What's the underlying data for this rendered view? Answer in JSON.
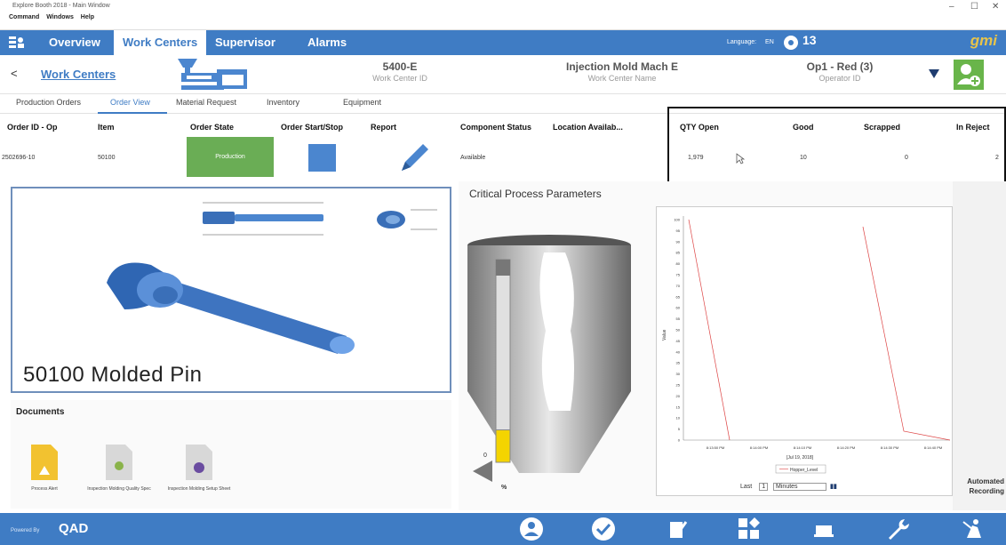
{
  "window": {
    "title": "Explore Booth 2018 - Main Window",
    "menu": [
      "Command",
      "Windows",
      "Help"
    ],
    "controls": [
      "–",
      "☐",
      "✕"
    ]
  },
  "nav": {
    "tabs": [
      "Overview",
      "Work Centers",
      "Supervisor",
      "Alarms"
    ],
    "active_tab": "Work Centers",
    "language_label": "Language:",
    "language_value": "EN",
    "alert_count": "13",
    "brand": "gmi"
  },
  "work_center": {
    "back_label": "<",
    "title": "Work Centers",
    "id_value": "5400-E",
    "id_label": "Work Center ID",
    "name_value": "Injection Mold Mach E",
    "name_label": "Work Center Name",
    "operator_value": "Op1 - Red (3)",
    "operator_label": "Operator ID"
  },
  "subtabs": [
    "Production Orders",
    "Order View",
    "Material Request",
    "Inventory",
    "Equipment"
  ],
  "active_subtab": "Order View",
  "order_table": {
    "headers": [
      "Order ID - Op",
      "Item",
      "Order State",
      "Order Start/Stop",
      "Report",
      "Component Status",
      "Location Availab...",
      "QTY Open",
      "Good",
      "Scrapped",
      "In Reject"
    ],
    "row": {
      "order_id": "2502696-10",
      "item": "50100",
      "state": "Production",
      "component_status": "Available",
      "qty_open": "1,979",
      "good": "10",
      "scrapped": "0",
      "in_reject": "2"
    }
  },
  "part": {
    "title": "50100 Molded Pin"
  },
  "documents": {
    "title": "Documents",
    "items": [
      {
        "label": "Process Alert",
        "color": "#f2c230"
      },
      {
        "label": "Inspection Molding Quality Spec",
        "color": "#8ab34a"
      },
      {
        "label": "Inspection Molding Setup Sheet",
        "color": "#6a4ca0"
      }
    ]
  },
  "critical": {
    "title": "Critical Process Parameters",
    "gauge_zero": "0",
    "gauge_unit": "%",
    "gauge_level": 0.16,
    "axis_ylabel": "Value",
    "time_labels": [
      "8:13:50 PM",
      "8:14:00 PM",
      "8:14:10 PM",
      "8:14:20 PM",
      "8:14:30 PM",
      "8:14:40 PM"
    ],
    "date_label": "[Jul 19, 2018]",
    "legend": "Hopper_Level",
    "last_label": "Last",
    "last_value": "1",
    "unit_value": "Minutes",
    "y_ticks": [
      "100",
      "95",
      "90",
      "85",
      "80",
      "75",
      "70",
      "65",
      "60",
      "55",
      "50",
      "45",
      "40",
      "35",
      "30",
      "25",
      "20",
      "15",
      "10",
      "5",
      "0"
    ]
  },
  "automated_recording": "Automated Recording",
  "footer": {
    "powered": "Powered By",
    "brand": "QAD"
  }
}
